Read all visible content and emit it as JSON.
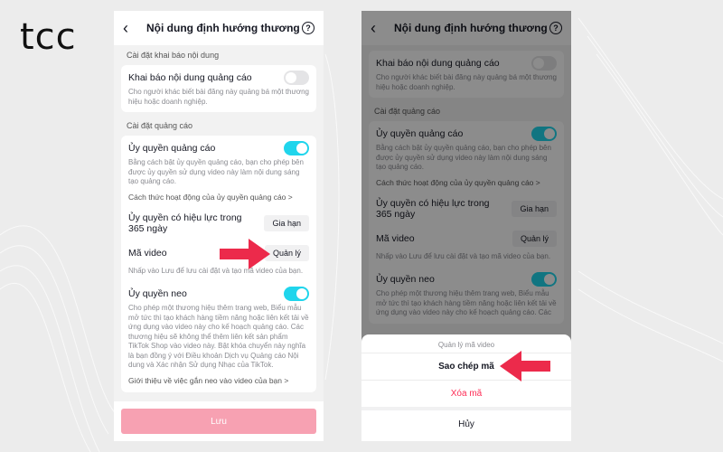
{
  "brand": {
    "logo_text": "tcc",
    "arrow_color": "#ec2a4b"
  },
  "colors": {
    "toggle_on": "#20d5ec",
    "danger": "#fe2c55",
    "save_disabled": "#f7a1b2"
  },
  "left": {
    "header": {
      "back_icon": "chevron-left-icon",
      "title": "Nội dung định hướng thương hiệ...",
      "help_icon": "question-circle-icon",
      "help_glyph": "?"
    },
    "disclosure_section": {
      "label": "Cài đặt khai báo nội dung",
      "item_title": "Khai báo nội dung quảng cáo",
      "item_desc": "Cho người khác biết bài đăng này quảng bá một thương hiệu hoặc doanh nghiệp.",
      "toggle": "off"
    },
    "ad_section": {
      "label": "Cài đặt quảng cáo",
      "auth_title": "Ủy quyền quảng cáo",
      "auth_desc": "Bằng cách bật ủy quyền quảng cáo, bạn cho phép bên được ủy quyền sử dụng video này làm nội dung sáng tạo quảng cáo.",
      "auth_link": "Cách thức hoạt động của ủy quyền quảng cáo >",
      "auth_toggle": "on",
      "validity_title": "Ủy quyền có hiệu lực trong 365 ngày",
      "extend_label": "Gia hạn",
      "video_code_title": "Mã video",
      "manage_label": "Quản lý",
      "video_code_desc": "Nhấp vào Lưu để lưu cài đặt và tạo mã video của bạn.",
      "anchor_title": "Ủy quyền neo",
      "anchor_desc": "Cho phép một thương hiệu thêm trang web, Biểu mẫu mở tức thì tạo khách hàng tiềm năng hoặc liên kết tải về ứng dụng vào video này cho kế hoạch quảng cáo. Các thương hiệu sẽ không thể thêm liên kết sản phẩm TikTok Shop vào video này. Bật khóa chuyển này nghĩa là bạn đồng ý với Điều khoản Dịch vụ Quảng cáo Nội dung và Xác nhận Sử dụng Nhạc của TikTok.",
      "anchor_link": "Giới thiệu về việc gắn neo vào video của bạn >",
      "anchor_toggle": "on"
    },
    "save_label": "Lưu"
  },
  "right": {
    "header": {
      "back_icon": "chevron-left-icon",
      "title": "Nội dung định hướng thương hiệ...",
      "help_icon": "question-circle-icon",
      "help_glyph": "?"
    },
    "disclosure": {
      "item_title": "Khai báo nội dung quảng cáo",
      "item_desc": "Cho người khác biết bài đăng này quảng bá một thương hiệu hoặc doanh nghiệp.",
      "toggle": "off"
    },
    "ad_section": {
      "label": "Cài đặt quảng cáo",
      "auth_title": "Ủy quyền quảng cáo",
      "auth_desc": "Bằng cách bật ủy quyền quảng cáo, bạn cho phép bên được ủy quyền sử dụng video này làm nội dung sáng tạo quảng cáo.",
      "auth_link": "Cách thức hoạt động của ủy quyền quảng cáo >",
      "validity_title": "Ủy quyền có hiệu lực trong 365 ngày",
      "extend_label": "Gia hạn",
      "video_code_title": "Mã video",
      "manage_label": "Quản lý",
      "video_code_desc": "Nhấp vào Lưu để lưu cài đặt và tạo mã video của bạn.",
      "anchor_title": "Ủy quyền neo",
      "anchor_desc": "Cho phép một thương hiệu thêm trang web, Biểu mẫu mở tức thì tạo khách hàng tiềm năng hoặc liên kết tải về ứng dụng vào video này cho kế hoạch quảng cáo. Các"
    },
    "sheet": {
      "header": "Quản lý mã video",
      "copy_label": "Sao chép mã",
      "delete_label": "Xóa mã",
      "cancel_label": "Hủy"
    }
  }
}
